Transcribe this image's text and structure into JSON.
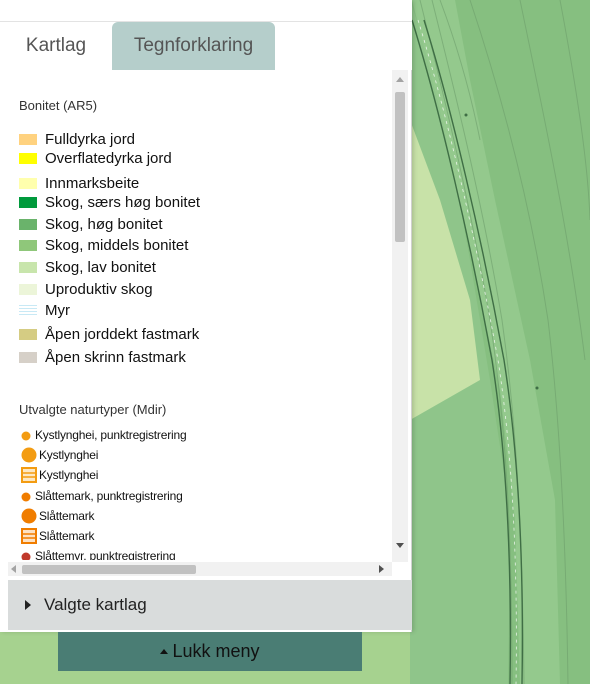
{
  "tabs": [
    {
      "label": "Kartlag",
      "active": false
    },
    {
      "label": "Tegnforklaring",
      "active": true
    }
  ],
  "legend": {
    "bonitet_title": "Bonitet (AR5)",
    "bonitet_items": [
      {
        "label": "Fulldyrka jord",
        "color": "#ffd27f"
      },
      {
        "label": "Overflatedyrka jord",
        "color": "#ffff00"
      },
      {
        "label": "Innmarksbeite",
        "color": "#ffffad"
      },
      {
        "label": "Skog, særs høg bonitet",
        "color": "#009a3c"
      },
      {
        "label": "Skog, høg bonitet",
        "color": "#6ab36b"
      },
      {
        "label": "Skog, middels bonitet",
        "color": "#8fc77a"
      },
      {
        "label": "Skog, lav bonitet",
        "color": "#c8e5ac"
      },
      {
        "label": "Uproduktiv skog",
        "color": "#ecf5d9"
      },
      {
        "label": "Myr",
        "color": "#c8e9f5"
      },
      {
        "label": "Åpen jorddekt fastmark",
        "color": "#d5cc83"
      },
      {
        "label": "Åpen skrinn fastmark",
        "color": "#d6d0c8"
      }
    ],
    "naturtyper_title": "Utvalgte naturtyper (Mdir)",
    "naturtyper_items": [
      {
        "label": "Kystlynghei, punktregistrering",
        "symbol": "dot-small",
        "color": "#f39c12"
      },
      {
        "label": "Kystlynghei",
        "symbol": "dot-large",
        "color": "#f39c12"
      },
      {
        "label": "Kystlynghei",
        "symbol": "polygon",
        "color": "#f39c12"
      },
      {
        "label": "Slåttemark, punktregistrering",
        "symbol": "dot-small",
        "color": "#f07d00"
      },
      {
        "label": "Slåttemark",
        "symbol": "dot-large",
        "color": "#f07d00"
      },
      {
        "label": "Slåttemark",
        "symbol": "polygon",
        "color": "#f07d00"
      },
      {
        "label": "Slåttemyr, punktregistrering",
        "symbol": "dot-small",
        "color": "#c0392b"
      }
    ]
  },
  "valgte_kartlag": {
    "label": "Valgte kartlag"
  },
  "lukk_meny": {
    "label": "Lukk meny"
  }
}
